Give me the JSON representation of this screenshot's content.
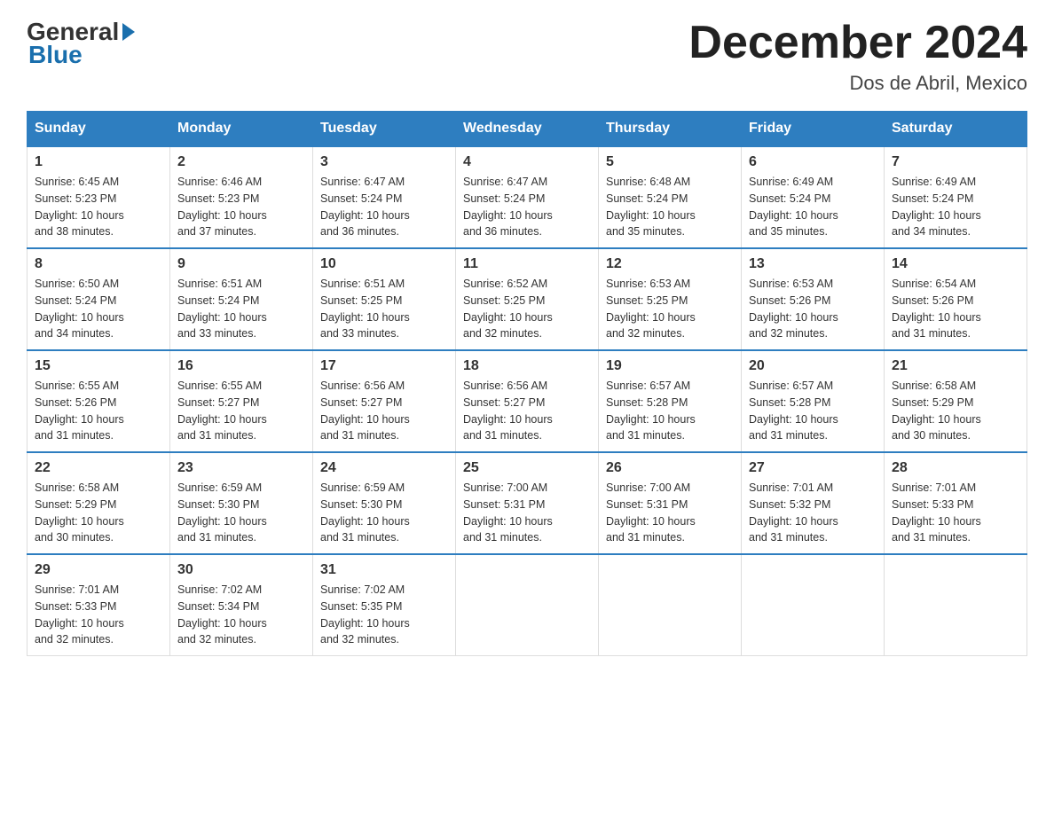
{
  "logo": {
    "general_text": "General",
    "blue_text": "Blue"
  },
  "title": "December 2024",
  "subtitle": "Dos de Abril, Mexico",
  "days_of_week": [
    "Sunday",
    "Monday",
    "Tuesday",
    "Wednesday",
    "Thursday",
    "Friday",
    "Saturday"
  ],
  "weeks": [
    [
      {
        "num": "1",
        "sunrise": "6:45 AM",
        "sunset": "5:23 PM",
        "daylight": "10 hours and 38 minutes."
      },
      {
        "num": "2",
        "sunrise": "6:46 AM",
        "sunset": "5:23 PM",
        "daylight": "10 hours and 37 minutes."
      },
      {
        "num": "3",
        "sunrise": "6:47 AM",
        "sunset": "5:24 PM",
        "daylight": "10 hours and 36 minutes."
      },
      {
        "num": "4",
        "sunrise": "6:47 AM",
        "sunset": "5:24 PM",
        "daylight": "10 hours and 36 minutes."
      },
      {
        "num": "5",
        "sunrise": "6:48 AM",
        "sunset": "5:24 PM",
        "daylight": "10 hours and 35 minutes."
      },
      {
        "num": "6",
        "sunrise": "6:49 AM",
        "sunset": "5:24 PM",
        "daylight": "10 hours and 35 minutes."
      },
      {
        "num": "7",
        "sunrise": "6:49 AM",
        "sunset": "5:24 PM",
        "daylight": "10 hours and 34 minutes."
      }
    ],
    [
      {
        "num": "8",
        "sunrise": "6:50 AM",
        "sunset": "5:24 PM",
        "daylight": "10 hours and 34 minutes."
      },
      {
        "num": "9",
        "sunrise": "6:51 AM",
        "sunset": "5:24 PM",
        "daylight": "10 hours and 33 minutes."
      },
      {
        "num": "10",
        "sunrise": "6:51 AM",
        "sunset": "5:25 PM",
        "daylight": "10 hours and 33 minutes."
      },
      {
        "num": "11",
        "sunrise": "6:52 AM",
        "sunset": "5:25 PM",
        "daylight": "10 hours and 32 minutes."
      },
      {
        "num": "12",
        "sunrise": "6:53 AM",
        "sunset": "5:25 PM",
        "daylight": "10 hours and 32 minutes."
      },
      {
        "num": "13",
        "sunrise": "6:53 AM",
        "sunset": "5:26 PM",
        "daylight": "10 hours and 32 minutes."
      },
      {
        "num": "14",
        "sunrise": "6:54 AM",
        "sunset": "5:26 PM",
        "daylight": "10 hours and 31 minutes."
      }
    ],
    [
      {
        "num": "15",
        "sunrise": "6:55 AM",
        "sunset": "5:26 PM",
        "daylight": "10 hours and 31 minutes."
      },
      {
        "num": "16",
        "sunrise": "6:55 AM",
        "sunset": "5:27 PM",
        "daylight": "10 hours and 31 minutes."
      },
      {
        "num": "17",
        "sunrise": "6:56 AM",
        "sunset": "5:27 PM",
        "daylight": "10 hours and 31 minutes."
      },
      {
        "num": "18",
        "sunrise": "6:56 AM",
        "sunset": "5:27 PM",
        "daylight": "10 hours and 31 minutes."
      },
      {
        "num": "19",
        "sunrise": "6:57 AM",
        "sunset": "5:28 PM",
        "daylight": "10 hours and 31 minutes."
      },
      {
        "num": "20",
        "sunrise": "6:57 AM",
        "sunset": "5:28 PM",
        "daylight": "10 hours and 31 minutes."
      },
      {
        "num": "21",
        "sunrise": "6:58 AM",
        "sunset": "5:29 PM",
        "daylight": "10 hours and 30 minutes."
      }
    ],
    [
      {
        "num": "22",
        "sunrise": "6:58 AM",
        "sunset": "5:29 PM",
        "daylight": "10 hours and 30 minutes."
      },
      {
        "num": "23",
        "sunrise": "6:59 AM",
        "sunset": "5:30 PM",
        "daylight": "10 hours and 31 minutes."
      },
      {
        "num": "24",
        "sunrise": "6:59 AM",
        "sunset": "5:30 PM",
        "daylight": "10 hours and 31 minutes."
      },
      {
        "num": "25",
        "sunrise": "7:00 AM",
        "sunset": "5:31 PM",
        "daylight": "10 hours and 31 minutes."
      },
      {
        "num": "26",
        "sunrise": "7:00 AM",
        "sunset": "5:31 PM",
        "daylight": "10 hours and 31 minutes."
      },
      {
        "num": "27",
        "sunrise": "7:01 AM",
        "sunset": "5:32 PM",
        "daylight": "10 hours and 31 minutes."
      },
      {
        "num": "28",
        "sunrise": "7:01 AM",
        "sunset": "5:33 PM",
        "daylight": "10 hours and 31 minutes."
      }
    ],
    [
      {
        "num": "29",
        "sunrise": "7:01 AM",
        "sunset": "5:33 PM",
        "daylight": "10 hours and 32 minutes."
      },
      {
        "num": "30",
        "sunrise": "7:02 AM",
        "sunset": "5:34 PM",
        "daylight": "10 hours and 32 minutes."
      },
      {
        "num": "31",
        "sunrise": "7:02 AM",
        "sunset": "5:35 PM",
        "daylight": "10 hours and 32 minutes."
      },
      null,
      null,
      null,
      null
    ]
  ],
  "labels": {
    "sunrise": "Sunrise:",
    "sunset": "Sunset:",
    "daylight": "Daylight:"
  }
}
